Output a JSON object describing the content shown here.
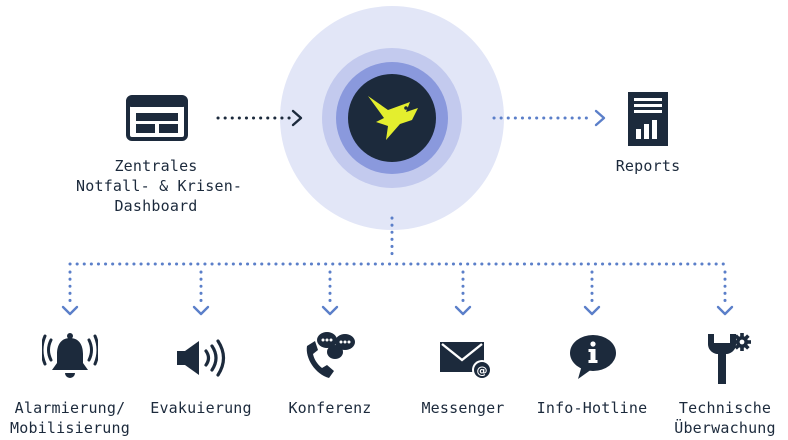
{
  "colors": {
    "navy": "#1c2a3c",
    "blue_dots": "#5b7fc9",
    "halo_outer": "#e2e6f7",
    "halo_mid": "#c3caee",
    "halo_inner": "#8a99dd",
    "bird": "#e4ee2e"
  },
  "center": {
    "icon": "bird-logo-icon"
  },
  "left": {
    "icon": "dashboard-window-icon",
    "label_line1": "Zentrales",
    "label_line2": "Notfall- & Krisen-",
    "label_line3": "Dashboard"
  },
  "right": {
    "icon": "report-chart-icon",
    "label": "Reports"
  },
  "bottom": [
    {
      "icon": "alarm-bell-icon",
      "line1": "Alarmierung/",
      "line2": "Mobilisierung"
    },
    {
      "icon": "speaker-icon",
      "line1": "Evakuierung",
      "line2": ""
    },
    {
      "icon": "phone-chat-icon",
      "line1": "Konferenz",
      "line2": ""
    },
    {
      "icon": "envelope-at-icon",
      "line1": "Messenger",
      "line2": ""
    },
    {
      "icon": "info-bubble-icon",
      "line1": "Info-Hotline",
      "line2": ""
    },
    {
      "icon": "wrench-gear-icon",
      "line1": "Technische",
      "line2": "Überwachung"
    }
  ]
}
